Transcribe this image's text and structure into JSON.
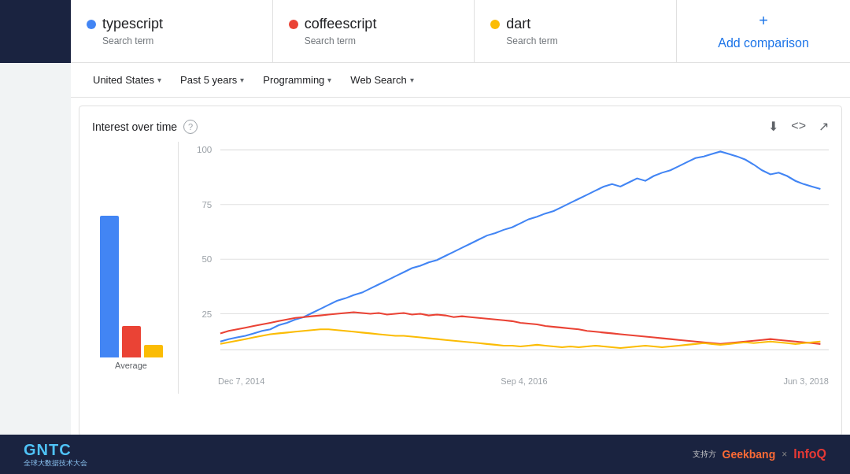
{
  "decoration": {
    "circle_color": "#1a2340"
  },
  "search_terms": [
    {
      "name": "typescript",
      "label": "Search term",
      "dot_color": "#4285f4"
    },
    {
      "name": "coffeescript",
      "label": "Search term",
      "dot_color": "#ea4335"
    },
    {
      "name": "dart",
      "label": "Search term",
      "dot_color": "#fbbc04"
    }
  ],
  "add_comparison": {
    "label": "Add comparison",
    "plus": "+"
  },
  "filters": [
    {
      "label": "United States",
      "has_chevron": true
    },
    {
      "label": "Past 5 years",
      "has_chevron": true
    },
    {
      "label": "Programming",
      "has_chevron": true
    },
    {
      "label": "Web Search",
      "has_chevron": true
    }
  ],
  "chart": {
    "title": "Interest over time",
    "help_icon": "?",
    "actions": [
      "download-icon",
      "embed-icon",
      "share-icon"
    ],
    "y_axis": [
      "100",
      "75",
      "50",
      "25",
      ""
    ],
    "x_axis": [
      "Dec 7, 2014",
      "Sep 4, 2016",
      "Jun 3, 2018"
    ],
    "bars": [
      {
        "color": "#4285f4",
        "height_pct": 90
      },
      {
        "color": "#ea4335",
        "height_pct": 20
      },
      {
        "color": "#fbbc04",
        "height_pct": 8
      }
    ],
    "bar_label": "Average"
  },
  "bottom_bar": {
    "left_logo": "GNTC",
    "left_subtitle_line1": "全球大数据技术大会",
    "right_support": "支持方",
    "right_geekbang": "Geekbang",
    "right_infoq": "InfoQ"
  }
}
